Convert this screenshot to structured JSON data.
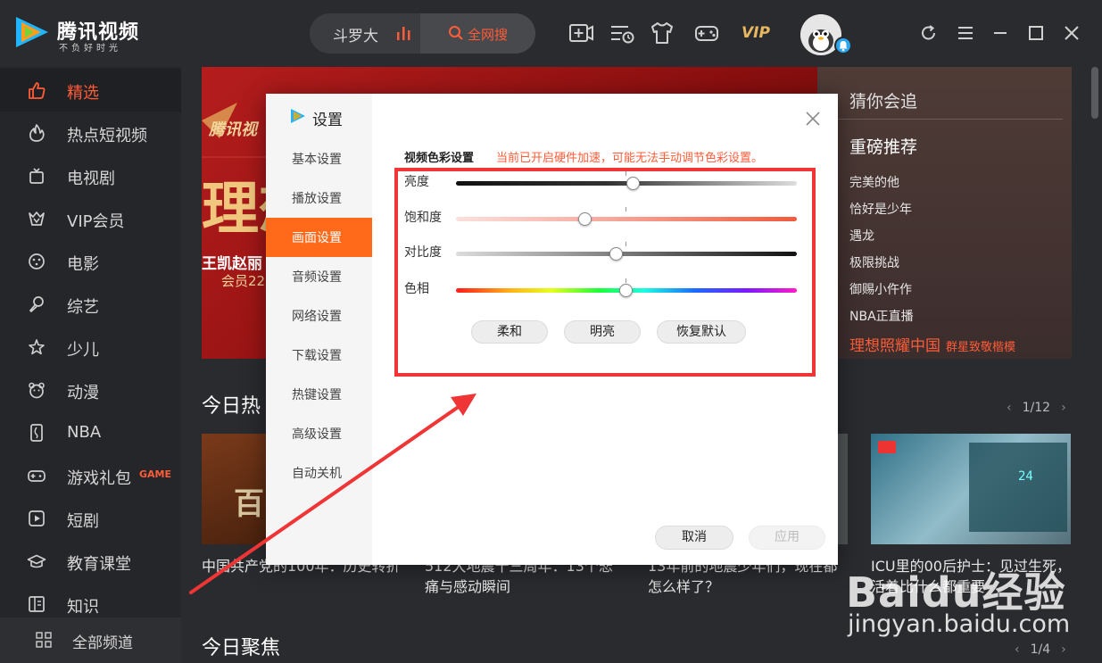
{
  "app": {
    "name": "腾讯视频",
    "slogan": "不负好时光"
  },
  "search": {
    "query": "斗罗大",
    "button_label": "全网搜"
  },
  "header": {
    "vip_label": "VIP"
  },
  "sidebar": {
    "items": [
      {
        "label": "精选",
        "icon": "thumbs-up-icon",
        "active": true
      },
      {
        "label": "热点短视频",
        "icon": "flame-icon"
      },
      {
        "label": "电视剧",
        "icon": "tv-icon"
      },
      {
        "label": "VIP会员",
        "icon": "vip-crown-icon"
      },
      {
        "label": "电影",
        "icon": "film-reel-icon"
      },
      {
        "label": "综艺",
        "icon": "microphone-icon"
      },
      {
        "label": "少儿",
        "icon": "star-child-icon"
      },
      {
        "label": "动漫",
        "icon": "bear-face-icon"
      },
      {
        "label": "NBA",
        "icon": "nba-icon"
      },
      {
        "label": "游戏礼包",
        "icon": "gamepad-icon",
        "badge": "GAME"
      },
      {
        "label": "短剧",
        "icon": "play-square-icon"
      },
      {
        "label": "教育课堂",
        "icon": "graduation-cap-icon"
      },
      {
        "label": "知识",
        "icon": "book-icon"
      }
    ],
    "all_channels": "全部频道"
  },
  "banner": {
    "logo_text": "腾讯视",
    "headline": "理想",
    "sub1": "王凯赵丽",
    "sub2": "会员22"
  },
  "side_panel": {
    "guess_title": "猜你会追",
    "rec_title": "重磅推荐",
    "items": [
      "完美的他",
      "恰好是少年",
      "遇龙",
      "极限挑战",
      "御赐小仵作",
      "NBA正直播"
    ],
    "highlight": "理想照耀中国",
    "highlight_sub": "群星致敬楷模"
  },
  "section1": {
    "title": "今日热",
    "pager": "1/12"
  },
  "section2": {
    "title": "今日聚焦",
    "pager": "1/4"
  },
  "cards": [
    {
      "caption": "中国共产党的100年：历史转折"
    },
    {
      "caption": "512大地震十三周年：13个悲痛与感动瞬间"
    },
    {
      "caption": "13年前的地震少年们，现在都怎么样了？"
    },
    {
      "caption": "ICU里的00后护士：见过生死，活着比什么都重要"
    }
  ],
  "dialog": {
    "title": "设置",
    "tabs": [
      "基本设置",
      "播放设置",
      "画面设置",
      "音频设置",
      "网络设置",
      "下载设置",
      "热键设置",
      "高级设置",
      "自动关机"
    ],
    "active_tab": "画面设置",
    "color_section_title": "视频色彩设置",
    "color_warning": "当前已开启硬件加速，可能无法手动调节色彩设置。",
    "sliders": [
      {
        "label": "亮度",
        "value": 0.52
      },
      {
        "label": "饱和度",
        "value": 0.38
      },
      {
        "label": "对比度",
        "value": 0.47
      },
      {
        "label": "色相",
        "value": 0.5
      }
    ],
    "presets": [
      "柔和",
      "明亮",
      "恢复默认"
    ],
    "cancel": "取消",
    "apply": "应用"
  },
  "watermark": {
    "brand": "Baidu经验",
    "url": "jingyan.baidu.com"
  },
  "colors": {
    "accent": "#ff5c38",
    "active_tab": "#ff6a1a",
    "highlight_box": "#ef3535"
  }
}
